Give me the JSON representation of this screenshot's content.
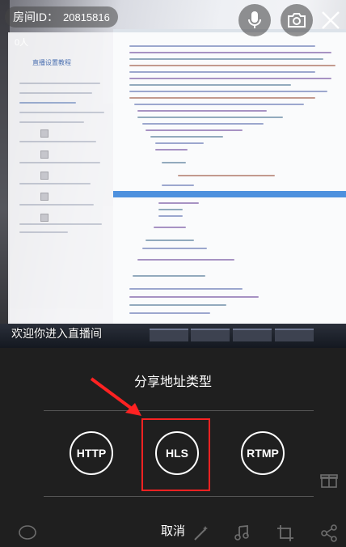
{
  "header": {
    "room_label": "房间ID：",
    "room_id": "20815816",
    "viewer_count": "0人"
  },
  "top_buttons": [
    "mic-icon",
    "camera-switch-icon",
    "close-icon"
  ],
  "preview": {
    "doc_title": "直播设置教程",
    "welcome_text": "欢迎你进入直播间"
  },
  "share_sheet": {
    "title": "分享地址类型",
    "options": [
      "HTTP",
      "HLS",
      "RTMP"
    ],
    "highlighted_option": "HLS",
    "cancel_label": "取消"
  },
  "annotation_colors": {
    "arrow": "#ff2222",
    "box": "#ff2222"
  },
  "bottom_toolbar_icons": [
    "comment-icon",
    "beauty-wand-icon",
    "music-icon",
    "crop-icon",
    "share-icon",
    "gift-icon"
  ]
}
